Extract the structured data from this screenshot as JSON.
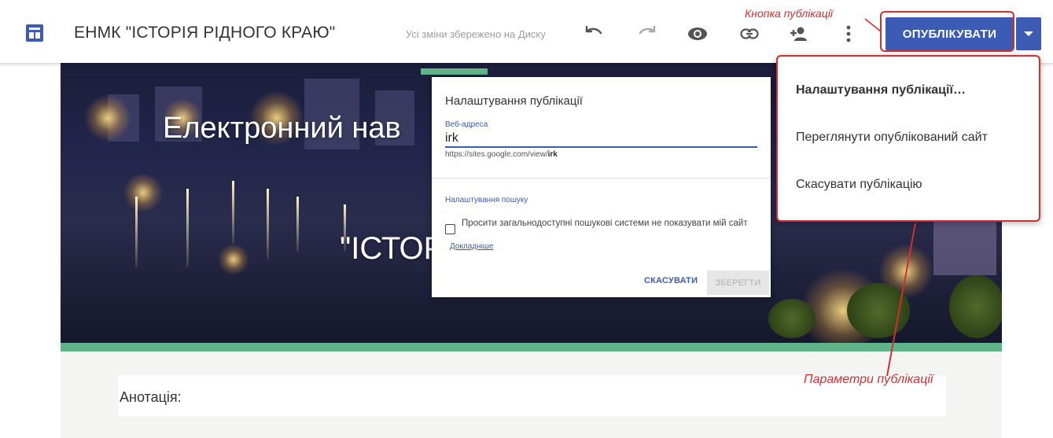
{
  "header": {
    "site_title": "ЕНМК \"ІСТОРІЯ РІДНОГО КРАЮ\"",
    "save_status": "Усі зміни збережено на Диску",
    "publish_label": "ОПУБЛІКУВАТИ",
    "icons": [
      "sites-logo-icon",
      "undo-icon",
      "redo-icon",
      "preview-eye-icon",
      "link-icon",
      "add-person-icon",
      "more-vert-icon",
      "dropdown-arrow-icon"
    ]
  },
  "hero": {
    "title_line1": "Електронний нав",
    "title_line2": "\"ІСТОР"
  },
  "annotation_box": {
    "label": "Анотація:"
  },
  "dialog": {
    "title": "Налаштування публікації",
    "url_label": "Веб-адреса",
    "url_value": "irk",
    "url_prefix": "https://sites.google.com/view/",
    "url_suffix": "irk",
    "search_settings_label": "Налаштування пошуку",
    "checkbox_label": "Просити загальнодоступні пошукові системи не показувати мій сайт",
    "checkbox_checked": false,
    "learn_more": "Докладніше",
    "cancel_label": "СКАСУВАТИ",
    "save_label": "ЗБЕРЕГТИ"
  },
  "menu": {
    "items": [
      {
        "label": "Налаштування публікації…"
      },
      {
        "label": "Переглянути опублікований сайт"
      },
      {
        "label": "Скасувати публікацію"
      }
    ]
  },
  "callouts": {
    "publish_button": "Кнопка публікації",
    "publish_options": "Параметри публікації"
  },
  "colors": {
    "accent_blue": "#3b5bb5",
    "annotation_red": "#d32f2f",
    "green_band": "#5fb58a"
  }
}
